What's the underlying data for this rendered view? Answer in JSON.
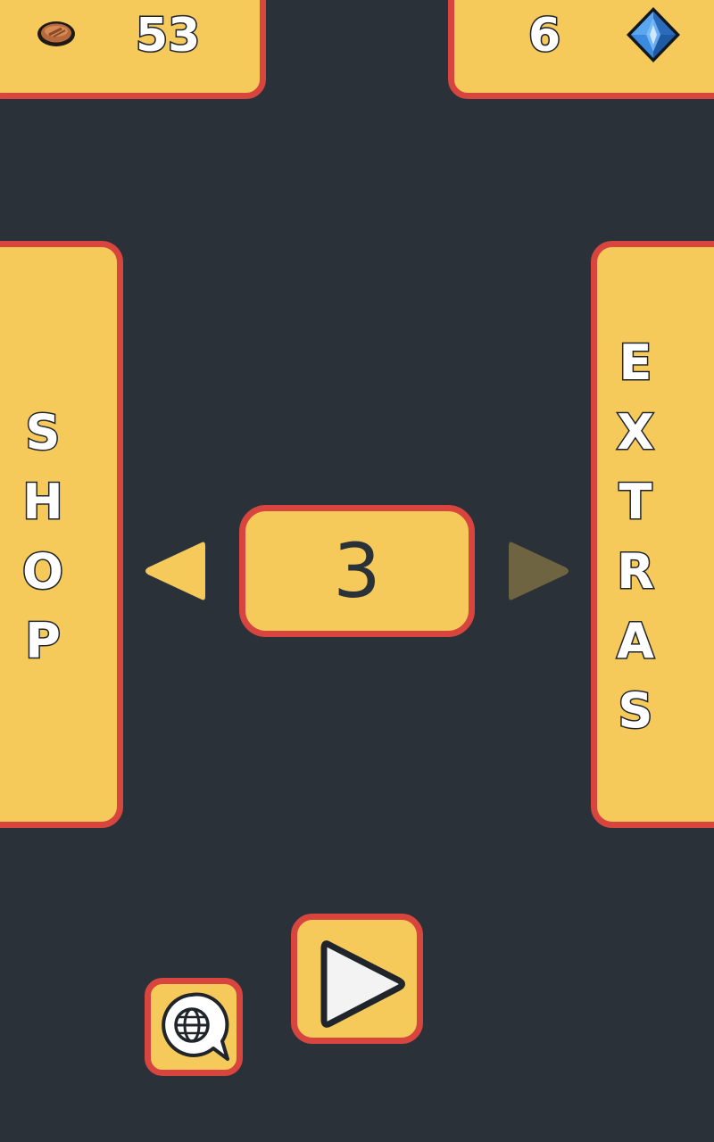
{
  "currency": {
    "coins": "53",
    "gems": "6",
    "coin_icon": "coin-icon",
    "gem_icon": "blue-gem-icon"
  },
  "side_buttons": {
    "shop_label": [
      "S",
      "H",
      "O",
      "P"
    ],
    "extras_label": [
      "E",
      "X",
      "T",
      "R",
      "A",
      "S"
    ]
  },
  "level_selector": {
    "level": "3",
    "prev_icon": "triangle-left-icon",
    "next_icon": "triangle-right-icon",
    "next_enabled": false
  },
  "actions": {
    "play_icon": "play-icon",
    "language_icon": "globe-speech-bubble-icon"
  },
  "colors": {
    "background": "#2a3139",
    "panel_fill": "#f5c95a",
    "panel_border": "#d8453f",
    "text_dark": "#2a3139",
    "text_light": "#ffffff"
  }
}
